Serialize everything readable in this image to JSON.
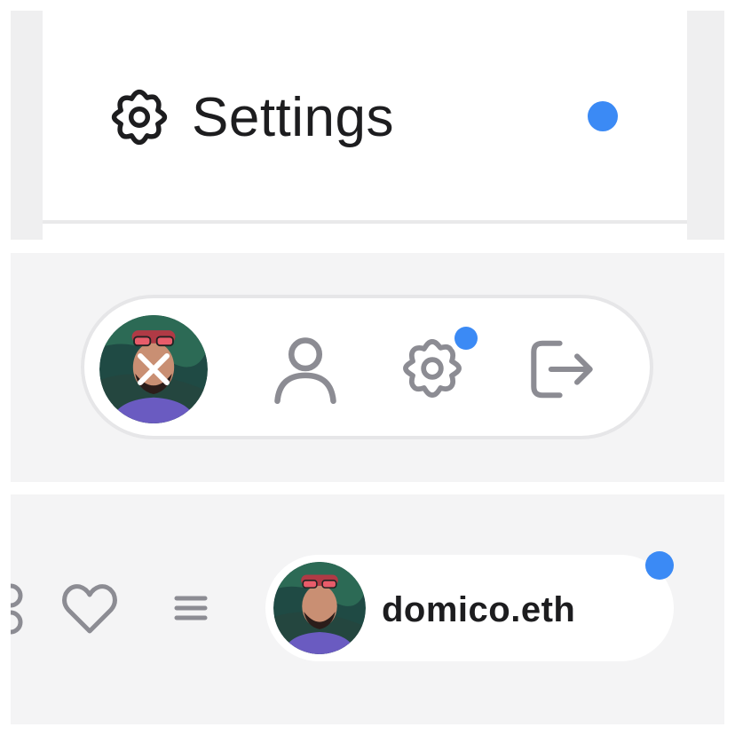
{
  "settings_menu": {
    "label": "Settings",
    "icon": "gear-icon",
    "notification_dot": true
  },
  "nav_bar": {
    "items": [
      {
        "name": "avatar-close",
        "icon": "close-icon"
      },
      {
        "name": "profile",
        "icon": "user-icon"
      },
      {
        "name": "settings",
        "icon": "gear-icon",
        "notification_dot": true
      },
      {
        "name": "logout",
        "icon": "logout-icon"
      }
    ]
  },
  "account_bar": {
    "icons": [
      "grid-icon",
      "heart-icon",
      "menu-icon"
    ],
    "account_name": "domico.eth",
    "notification_dot": true
  },
  "colors": {
    "accent": "#3b8af5",
    "icon_gray": "#8c8c93",
    "text_dark": "#1d1d1f"
  }
}
